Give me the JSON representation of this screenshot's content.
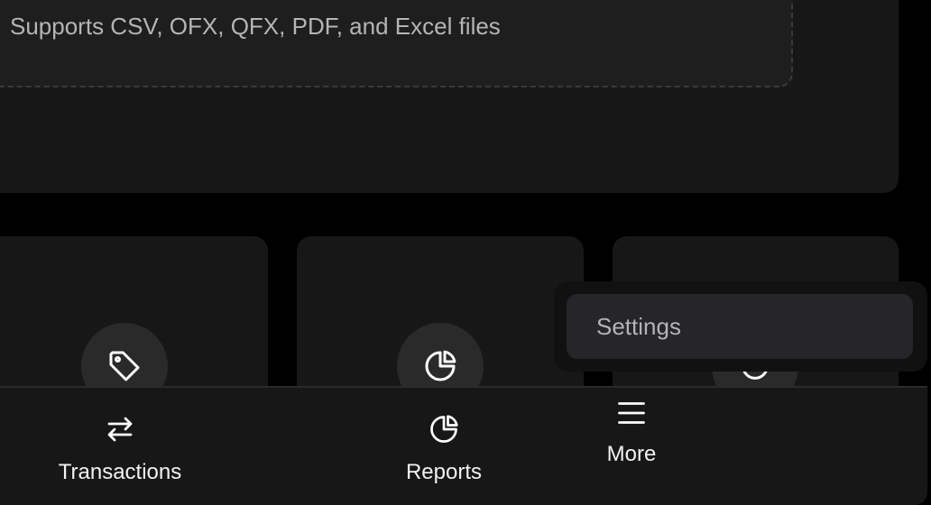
{
  "upload": {
    "supported_formats_text": "Supports CSV, OFX, QFX, PDF, and Excel files"
  },
  "tiles": [
    {
      "icon": "tag-icon"
    },
    {
      "icon": "pie-chart-icon"
    },
    {
      "icon": "circle-icon"
    }
  ],
  "bottom_nav": {
    "items": [
      {
        "label": "Transactions",
        "icon": "arrows-exchange-icon"
      },
      {
        "label": "Reports",
        "icon": "pie-chart-icon"
      },
      {
        "label": "More",
        "icon": "menu-icon"
      }
    ]
  },
  "more_menu": {
    "items": [
      {
        "label": "Settings"
      }
    ]
  }
}
